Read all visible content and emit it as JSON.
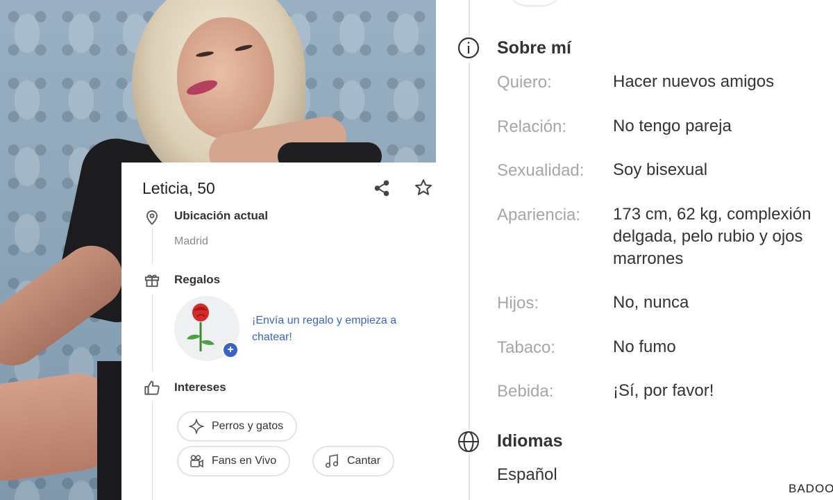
{
  "profile": {
    "name": "Leticia, 50",
    "location": {
      "title": "Ubicación actual",
      "value": "Madrid"
    },
    "gifts": {
      "title": "Regalos",
      "cta": "¡Envía un regalo y empieza a chatear!"
    },
    "interests": {
      "title": "Intereses",
      "items": [
        {
          "label": "Perros y gatos",
          "icon": "sparkle-icon"
        },
        {
          "label": "Fans en Vivo",
          "icon": "video-camera-icon"
        },
        {
          "label": "Cantar",
          "icon": "music-note-icon"
        }
      ]
    }
  },
  "about": {
    "title": "Sobre mí",
    "rows": [
      {
        "label": "Quiero:",
        "value": "Hacer nuevos amigos"
      },
      {
        "label": "Relación:",
        "value": "No tengo pareja"
      },
      {
        "label": "Sexualidad:",
        "value": "Soy bisexual"
      },
      {
        "label": "Apariencia:",
        "value_lines": [
          "173 cm, 62 kg, complexión",
          "delgada, pelo rubio y ojos",
          "marrones"
        ]
      },
      {
        "label": "Hijos:",
        "value": "No, nunca"
      },
      {
        "label": "Tabaco:",
        "value": "No fumo"
      },
      {
        "label": "Bebida:",
        "value": "¡Sí, por favor!"
      }
    ]
  },
  "languages": {
    "title": "Idiomas",
    "value": "Español"
  },
  "watermark": "BADOO",
  "colors": {
    "accent": "#3b65c4",
    "plus_badge": "#3a63c9",
    "label_gray": "#a6a6a6"
  }
}
